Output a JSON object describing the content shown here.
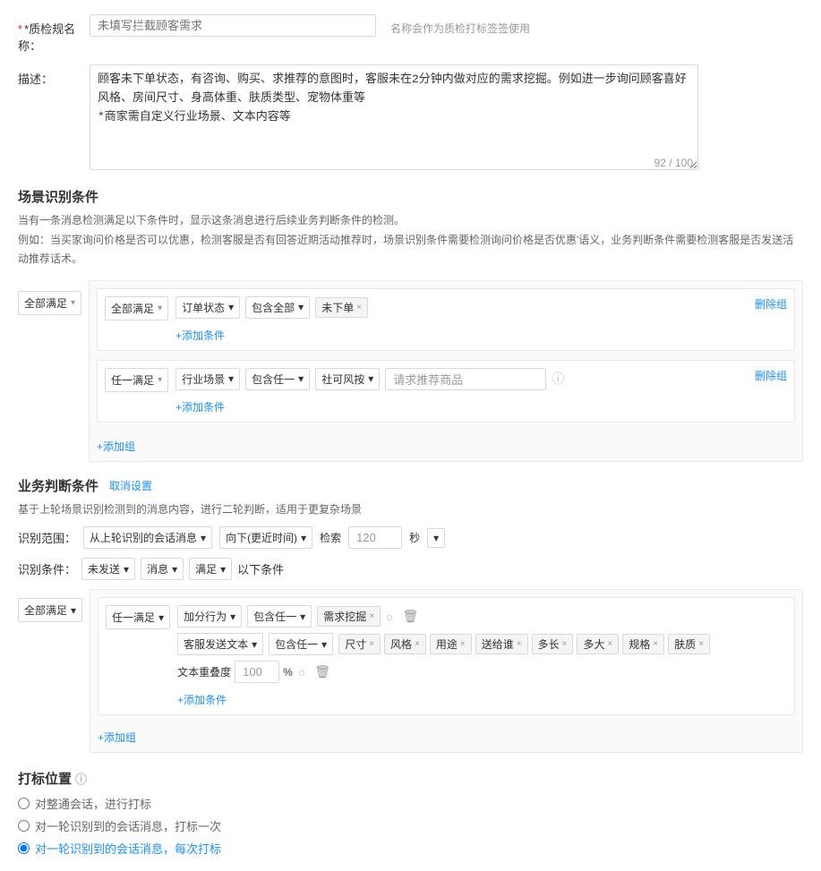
{
  "form": {
    "name_label": "*质检规名称：",
    "name_placeholder": "未填写拦截顾客需求",
    "name_hint": "名称会作为质检打标签签使用",
    "desc_label": "描述：",
    "desc_value": "顾客未下单状态，有咨询、购买、求推荐的意图时，客服未在2分钟内做对应的需求挖掘。例如进一步询问顾客喜好风格、房间尺寸、身高体重、肤质类型、宠物体重等\n*商家需自定义行业场景、文本内容等",
    "char_count": "92 / 100"
  },
  "scene_condition": {
    "title": "场景识别条件",
    "desc1": "当有一条消息检测满足以下条件时，显示这条消息进行后续业务判断条件的检测。",
    "desc2": "例如：当买家询问价格是否可以优惠，检测客服是否有回答近期活动推荐时，场景识别条件需要检测询问价格是否优惠'语义，业务判断条件需要检测客服是否发送活动推荐话术。",
    "outer_satisfy": "全部满足",
    "groups": [
      {
        "satisfy": "全部满足",
        "rows": [
          {
            "col1": "订单状态",
            "col2": "包含全部",
            "tags": [
              "未下单"
            ]
          }
        ],
        "delete_label": "删除组"
      },
      {
        "satisfy": "任一满足",
        "rows": [
          {
            "col1": "行业场景",
            "col2": "包含任一",
            "col3": "社可风按",
            "input_placeholder": "请求推荐商品"
          }
        ],
        "delete_label": "删除组"
      }
    ],
    "add_condition": "+添加条件",
    "add_group": "+添加组"
  },
  "business_condition": {
    "title": "业务判断条件",
    "desc": "基于上轮场景识别检测到的消息内容，进行二轮判断，适用于更复杂场景",
    "cancel_label": "取消设置",
    "range_label": "识别范围：",
    "range_select": "从上轮识别的会话消息",
    "direction": "向下(更近时间)",
    "search_label": "检索",
    "search_value": "120",
    "unit": "秒",
    "identify_label": "识别条件：",
    "identify_tags": [
      "未发送",
      "消息",
      "满足"
    ],
    "identify_suffix": "以下条件",
    "outer_satisfy": "全部满足",
    "group_satisfy": "任一满足",
    "rows": [
      {
        "col1": "加分行为",
        "col2": "包含任一",
        "tags": [
          "需求挖掘"
        ],
        "has_radio": true,
        "has_delete": true
      },
      {
        "col1": "客服发送文本",
        "col2": "包含任一",
        "tags2": [
          "尺寸",
          "风格",
          "用途",
          "送给谁",
          "多长",
          "多大",
          "规格",
          "肤质"
        ],
        "overlap_label": "文本重叠度",
        "overlap_value": "100",
        "overlap_unit": "%",
        "has_radio": true,
        "has_delete": true
      }
    ],
    "add_condition": "+添加条件",
    "add_group": "+添加组"
  },
  "mark_position": {
    "title": "打标位置",
    "info_icon": "ⓘ",
    "options": [
      {
        "label": "对整通会话，进行打标",
        "selected": false
      },
      {
        "label": "对一轮识别到的会话消息，打标一次",
        "selected": false
      },
      {
        "label": "对一轮识别到的会话消息，每次打标",
        "selected": true
      }
    ]
  },
  "icons": {
    "arrow_down": "▾",
    "close": "×",
    "add": "+",
    "info": "ⓘ",
    "radio_dot": "●",
    "delete": "🗑"
  }
}
